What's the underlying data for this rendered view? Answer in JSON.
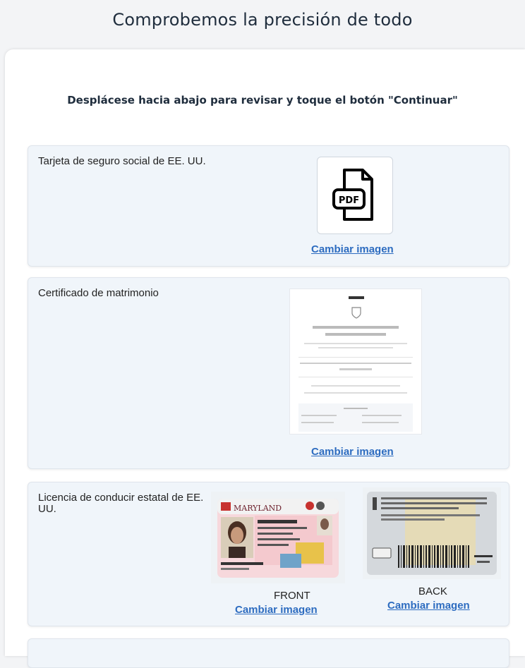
{
  "header": {
    "title": "Comprobemos la precisión de todo"
  },
  "instructions": "Desplácese hacia abajo para revisar y toque el botón \"Continuar\"",
  "documents": [
    {
      "label": "Tarjeta de seguro social de EE. UU.",
      "thumbnail_icon": "pdf-file-icon",
      "icon_text": "PDF",
      "change_link": "Cambiar imagen"
    },
    {
      "label": "Certificado de matrimonio",
      "change_link": "Cambiar imagen"
    },
    {
      "label": "Licencia de conducir estatal de EE. UU.",
      "front": {
        "side_label": "FRONT",
        "change_link": "Cambiar imagen",
        "card_state": "MARYLAND"
      },
      "back": {
        "side_label": "BACK",
        "change_link": "Cambiar imagen"
      }
    }
  ],
  "colors": {
    "link": "#2d6cc0",
    "card_bg": "#f0f5fa",
    "title": "#1f2d3d"
  }
}
